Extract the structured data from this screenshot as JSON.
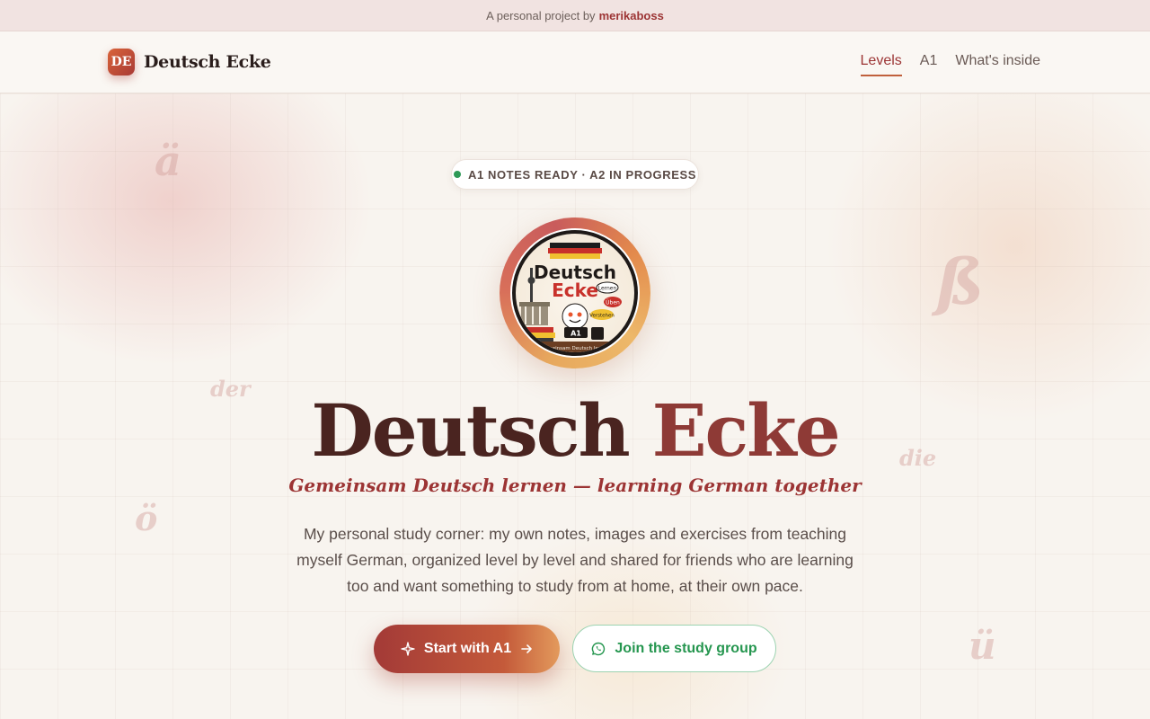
{
  "announcement": {
    "prefix": "A personal project by",
    "author": "merikaboss"
  },
  "brand": {
    "badge": "DE",
    "name": "Deutsch Ecke"
  },
  "nav": {
    "links": [
      {
        "label": "Levels",
        "active": true
      },
      {
        "label": "A1"
      },
      {
        "label": "What's inside"
      }
    ]
  },
  "status": {
    "text": "A1 NOTES READY · A2 IN PROGRESS",
    "dot_color": "#2e9a57"
  },
  "logo": {
    "title_line1": "Deutsch",
    "title_line2": "Ecke",
    "bubble1": "Lernen",
    "bubble2": "Üben",
    "bubble3": "Verstehen",
    "level": "A1",
    "banner": "Gemeinsam Deutsch lernen"
  },
  "decor": {
    "g1": "ä",
    "g2": "ß",
    "g3": "der",
    "g4": "die",
    "g5": "ö",
    "g6": "ü"
  },
  "hero": {
    "title_part1": "Deutsch",
    "title_part2": "Ecke",
    "subtitle": "Gemeinsam Deutsch lernen — learning German together",
    "description": "My personal study corner: my own notes, images and exercises from teaching myself German, organized level by level and shared for friends who are learning too and want something to study from at home, at their own pace."
  },
  "cta": {
    "primary": "Start with A1",
    "secondary": "Join the study group"
  },
  "icons": {
    "sparkle": "sparkle-icon",
    "arrow": "arrow-right-icon",
    "whatsapp": "whatsapp-icon"
  },
  "colors": {
    "accent": "#9c3434",
    "green": "#25964f"
  }
}
